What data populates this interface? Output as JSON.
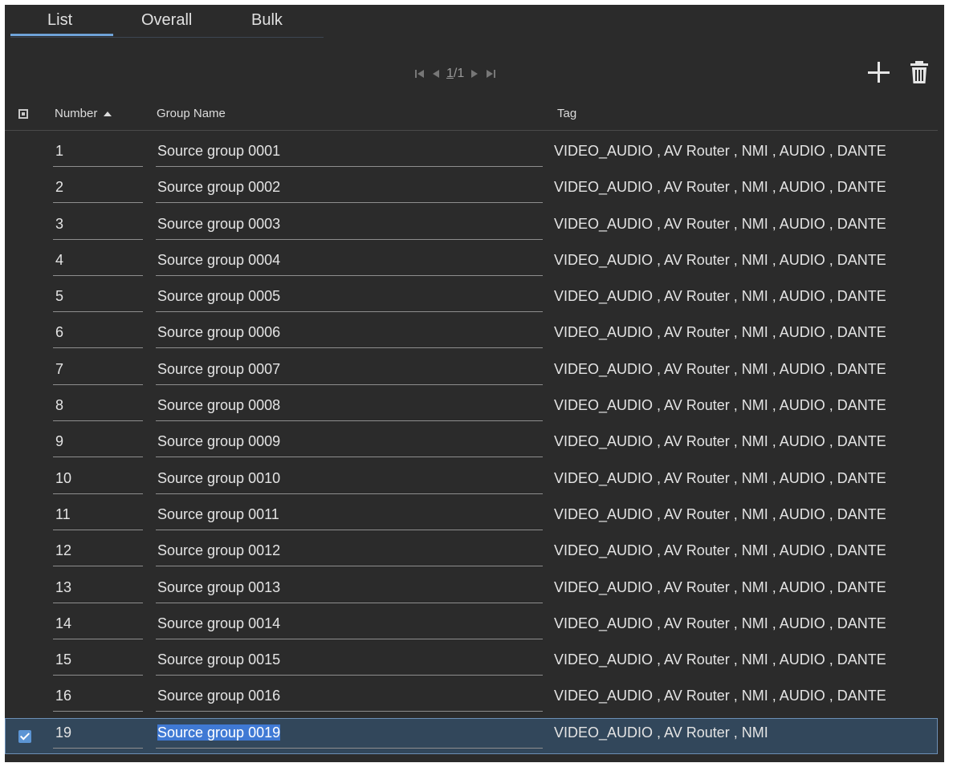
{
  "tabs": [
    "List",
    "Overall",
    "Bulk"
  ],
  "active_tab": "List",
  "pager": {
    "current": "1",
    "total": "1",
    "separator": "/"
  },
  "columns": {
    "number": "Number",
    "group_name": "Group Name",
    "tag": "Tag"
  },
  "rows": [
    {
      "number": "1",
      "group_name": "Source group 0001",
      "tag": "VIDEO_AUDIO , AV Router , NMI , AUDIO , DANTE"
    },
    {
      "number": "2",
      "group_name": "Source group 0002",
      "tag": "VIDEO_AUDIO , AV Router , NMI , AUDIO , DANTE"
    },
    {
      "number": "3",
      "group_name": "Source group 0003",
      "tag": "VIDEO_AUDIO , AV Router , NMI , AUDIO , DANTE"
    },
    {
      "number": "4",
      "group_name": "Source group 0004",
      "tag": "VIDEO_AUDIO , AV Router , NMI , AUDIO , DANTE"
    },
    {
      "number": "5",
      "group_name": "Source group 0005",
      "tag": "VIDEO_AUDIO , AV Router , NMI , AUDIO , DANTE"
    },
    {
      "number": "6",
      "group_name": "Source group 0006",
      "tag": "VIDEO_AUDIO , AV Router , NMI , AUDIO , DANTE"
    },
    {
      "number": "7",
      "group_name": "Source group 0007",
      "tag": "VIDEO_AUDIO , AV Router , NMI , AUDIO , DANTE"
    },
    {
      "number": "8",
      "group_name": "Source group 0008",
      "tag": "VIDEO_AUDIO , AV Router , NMI , AUDIO , DANTE"
    },
    {
      "number": "9",
      "group_name": "Source group 0009",
      "tag": "VIDEO_AUDIO , AV Router , NMI , AUDIO , DANTE"
    },
    {
      "number": "10",
      "group_name": "Source group 0010",
      "tag": "VIDEO_AUDIO , AV Router , NMI , AUDIO , DANTE"
    },
    {
      "number": "11",
      "group_name": "Source group 0011",
      "tag": "VIDEO_AUDIO , AV Router , NMI , AUDIO , DANTE"
    },
    {
      "number": "12",
      "group_name": "Source group 0012",
      "tag": "VIDEO_AUDIO , AV Router , NMI , AUDIO , DANTE"
    },
    {
      "number": "13",
      "group_name": "Source group 0013",
      "tag": "VIDEO_AUDIO , AV Router , NMI , AUDIO , DANTE"
    },
    {
      "number": "14",
      "group_name": "Source group 0014",
      "tag": "VIDEO_AUDIO , AV Router , NMI , AUDIO , DANTE"
    },
    {
      "number": "15",
      "group_name": "Source group 0015",
      "tag": "VIDEO_AUDIO , AV Router , NMI , AUDIO , DANTE"
    },
    {
      "number": "16",
      "group_name": "Source group 0016",
      "tag": "VIDEO_AUDIO , AV Router , NMI , AUDIO , DANTE"
    },
    {
      "number": "19",
      "group_name": "Source group 0019",
      "tag": "VIDEO_AUDIO , AV Router , NMI",
      "selected": true
    }
  ],
  "icons": {
    "add": "plus-icon",
    "delete": "trash-icon",
    "pager_first": "first-page-icon",
    "pager_prev": "prev-page-icon",
    "pager_next": "next-page-icon",
    "pager_last": "last-page-icon",
    "sort": "sort-ascending-icon"
  },
  "colors": {
    "background": "#2b2b2b",
    "accent": "#6fa3d8",
    "selected_row": "#32475b",
    "checkbox": "#5c95d4"
  }
}
